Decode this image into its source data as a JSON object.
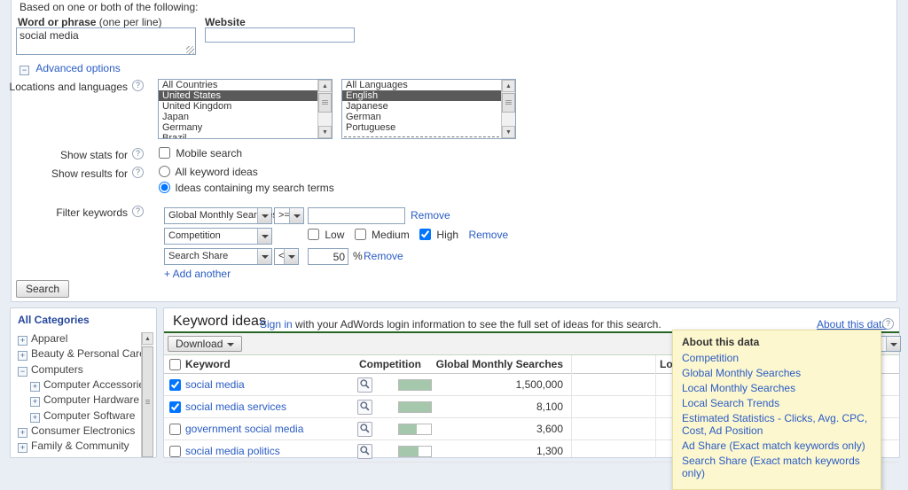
{
  "form": {
    "intro": "Based on one or both of the following:",
    "word": {
      "label": "Word or phrase",
      "hint": " (one per line)",
      "value": "social media"
    },
    "website": {
      "label": "Website",
      "value": ""
    },
    "advanced_label": "Advanced options",
    "locations_label": "Locations and languages",
    "countries": {
      "items": [
        "All Countries",
        "United States",
        "United Kingdom",
        "Japan",
        "Germany",
        "Brazil"
      ],
      "selected": "United States"
    },
    "languages": {
      "items": [
        "All Languages",
        "English",
        "Japanese",
        "German",
        "Portuguese"
      ],
      "selected": "English"
    },
    "show_stats": {
      "label": "Show stats for",
      "option": "Mobile search",
      "checked": false
    },
    "show_results": {
      "label": "Show results for",
      "options": [
        {
          "label": "All keyword ideas",
          "selected": false
        },
        {
          "label": "Ideas containing my search terms",
          "selected": true
        }
      ]
    },
    "filter": {
      "label": "Filter keywords",
      "rows": [
        {
          "field": "Global Monthly Searches",
          "op": ">=",
          "value": "",
          "remove": "Remove"
        },
        {
          "field": "Competition",
          "options": [
            {
              "label": "Low",
              "checked": false
            },
            {
              "label": "Medium",
              "checked": false
            },
            {
              "label": "High",
              "checked": true
            }
          ],
          "remove": "Remove"
        },
        {
          "field": "Search Share",
          "op": "<",
          "value": "50",
          "suffix": "%",
          "remove": "Remove"
        }
      ],
      "add_label": "+ Add another"
    },
    "search_button": "Search"
  },
  "categories": {
    "title": "All Categories",
    "items": [
      {
        "label": "Apparel",
        "level": 0,
        "expanded": false
      },
      {
        "label": "Beauty & Personal Care",
        "level": 0,
        "expanded": false
      },
      {
        "label": "Computers",
        "level": 0,
        "expanded": true
      },
      {
        "label": "Computer Accessories",
        "level": 1,
        "expanded": false
      },
      {
        "label": "Computer Hardware",
        "level": 1,
        "expanded": false
      },
      {
        "label": "Computer Software",
        "level": 1,
        "expanded": false
      },
      {
        "label": "Consumer Electronics",
        "level": 0,
        "expanded": false
      },
      {
        "label": "Family & Community",
        "level": 0,
        "expanded": false
      }
    ]
  },
  "results": {
    "title": "Keyword ideas",
    "signin_link": "Sign in",
    "signin_text": " with your AdWords login information to see the full set of ideas for this search.",
    "about_link": "About this data",
    "download_label": "Download",
    "columns": {
      "keyword": "Keyword",
      "competition": "Competition",
      "global": "Global Monthly Searches",
      "local": "Local Monthly Searches"
    },
    "rows": [
      {
        "keyword": "social media",
        "checked": true,
        "competition": 1.0,
        "global": "1,500,000"
      },
      {
        "keyword": "social media services",
        "checked": true,
        "competition": 1.0,
        "global": "8,100"
      },
      {
        "keyword": "government social media",
        "checked": false,
        "competition": 0.55,
        "global": "3,600"
      },
      {
        "keyword": "social media politics",
        "checked": false,
        "competition": 0.62,
        "global": "1,300"
      }
    ]
  },
  "tooltip": {
    "title": "About this data",
    "items": [
      "Competition",
      "Global Monthly Searches",
      "Local Monthly Searches",
      "Local Search Trends",
      "Estimated Statistics - Clicks, Avg. CPC, Cost, Ad Position",
      "Ad Share (Exact match keywords only)",
      "Search Share (Exact match keywords only)"
    ]
  },
  "colors": {
    "link": "#2a5cc4",
    "competition_bar_fill": "#a5c8ad",
    "header_divider_green": "#276627",
    "tooltip_bg": "#fcf7cf",
    "list_selected_bg": "#5a5a5a",
    "category_title": "#26479c"
  }
}
